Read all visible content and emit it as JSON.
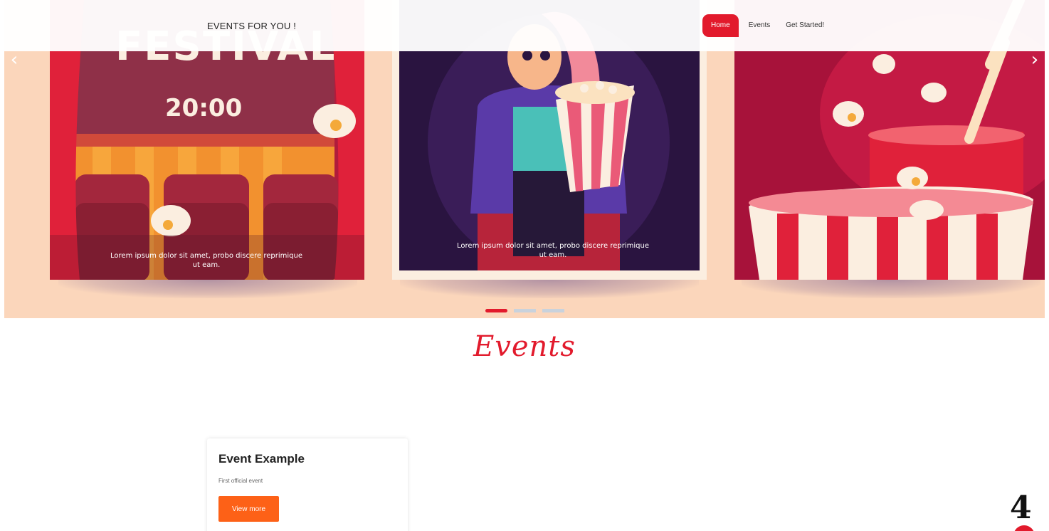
{
  "navbar": {
    "brand": "EVENTS FOR YOU !",
    "items": [
      {
        "label": "Home",
        "active": true
      },
      {
        "label": "Events",
        "active": false
      },
      {
        "label": "Get Started!",
        "active": false
      }
    ]
  },
  "carousel": {
    "slides": [
      {
        "heading": "FESTIVAL",
        "time": "20:00",
        "caption": "Lorem ipsum dolor sit amet, probo discere reprimique ut eam."
      },
      {
        "caption": "Lorem ipsum dolor sit amet, probo discere reprimique ut eam."
      },
      {
        "caption": ""
      }
    ],
    "indicators": [
      {
        "active": true
      },
      {
        "active": false
      },
      {
        "active": false
      }
    ],
    "prev_icon": "chevron-left-icon",
    "next_icon": "chevron-right-icon"
  },
  "events": {
    "heading": "Events",
    "cards": [
      {
        "title": "Event Example",
        "description": "First official event",
        "button_label": "View more"
      }
    ]
  },
  "page_number": "4",
  "colors": {
    "accent": "#e21a2c",
    "button": "#fd6117",
    "hero_bg": "#fbd6bb"
  }
}
